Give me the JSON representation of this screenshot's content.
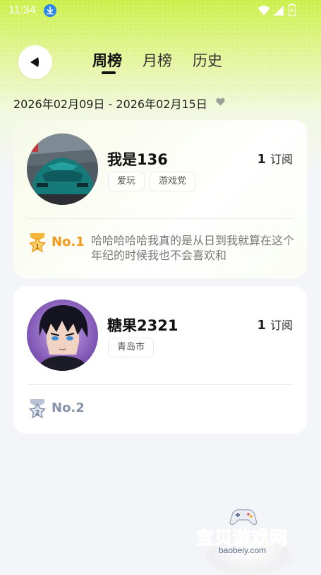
{
  "status_bar": {
    "time": "11:34",
    "icons": [
      "download-icon",
      "wifi-icon",
      "signal-icon",
      "battery-icon"
    ]
  },
  "header": {
    "back_icon": "back-arrow-icon",
    "tabs": [
      {
        "label": "周榜",
        "active": true
      },
      {
        "label": "月榜",
        "active": false
      },
      {
        "label": "历史",
        "active": false
      }
    ]
  },
  "date_range": "2026年02月09日 - 2026年02月15日",
  "date_icon": "heart-icon",
  "ranking": [
    {
      "name": "我是136",
      "subscribe_count": "1",
      "subscribe_label": "订阅",
      "tags": [
        "爱玩",
        "游戏党"
      ],
      "rank": "No.1",
      "medal": "gold-medal-icon",
      "comment": "哈哈哈哈哈我真的是从日到我就算在这个年纪的时候我也不会喜欢和"
    },
    {
      "name": "糖果2321",
      "subscribe_count": "1",
      "subscribe_label": "订阅",
      "tags": [
        "青岛市"
      ],
      "rank": "No.2",
      "medal": "silver-medal-icon",
      "comment": ""
    }
  ],
  "watermark": {
    "text": "宝贝游戏网",
    "url": "baobeiy.com"
  },
  "colors": {
    "accent_green": "#ccf04a",
    "gold": "#f39a1c",
    "silver": "#8593ab",
    "watermark_yellow": "#f5b301"
  }
}
